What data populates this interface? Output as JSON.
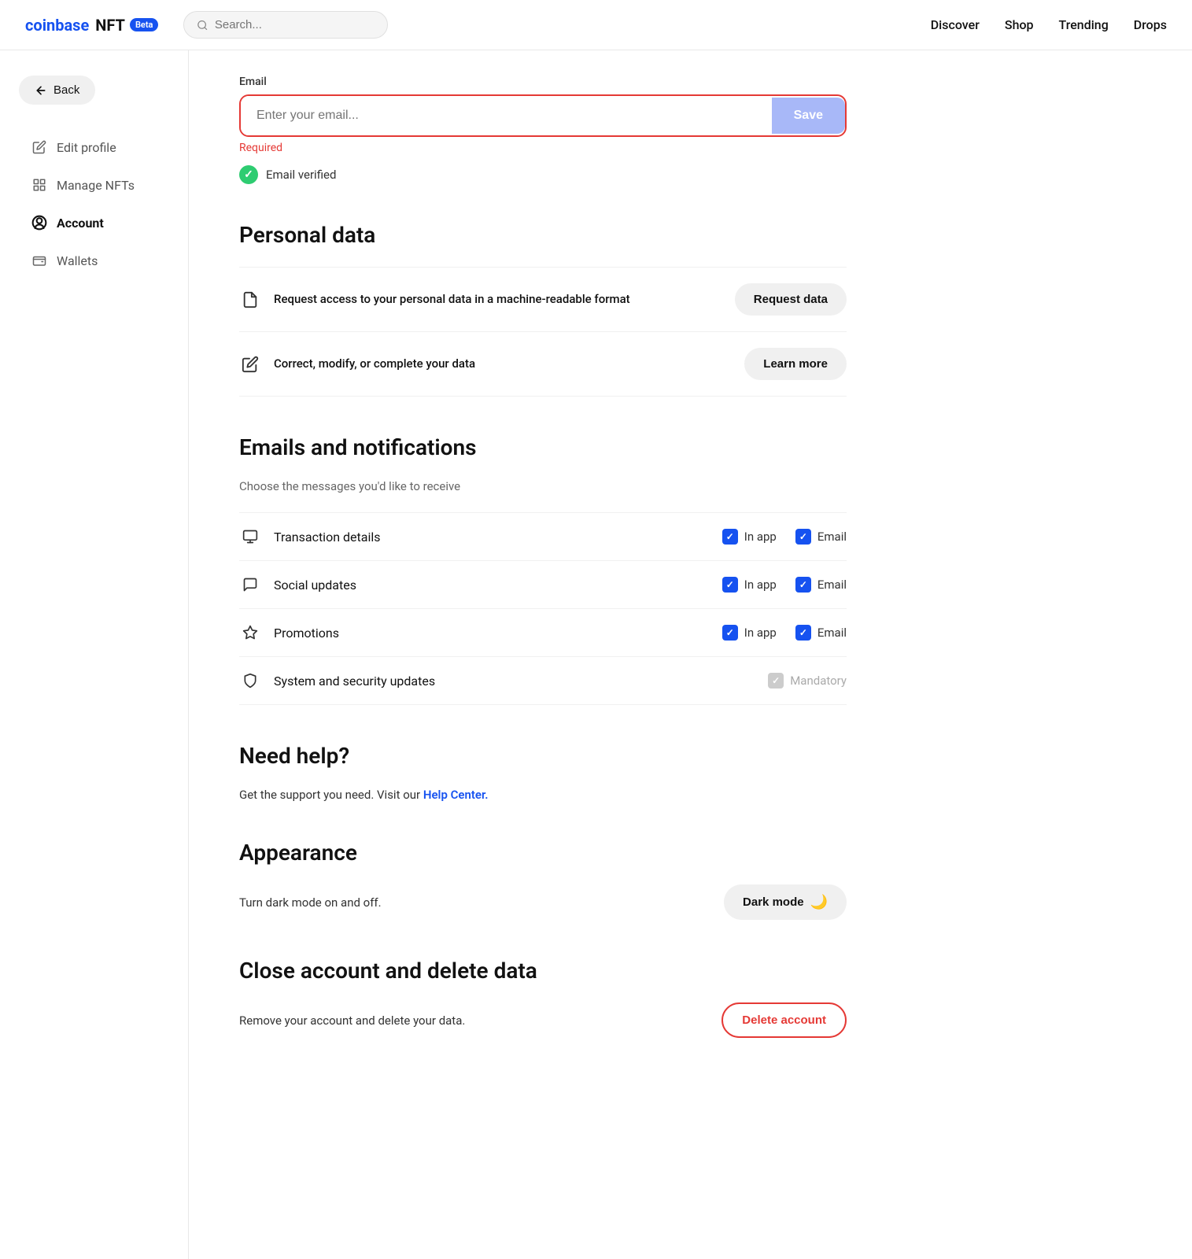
{
  "header": {
    "logo_coinbase": "coinbase",
    "logo_nft": "NFT",
    "beta_badge": "Beta",
    "search_placeholder": "Search...",
    "nav": [
      {
        "label": "Discover",
        "key": "discover"
      },
      {
        "label": "Shop",
        "key": "shop"
      },
      {
        "label": "Trending",
        "key": "trending"
      },
      {
        "label": "Drops",
        "key": "drops"
      }
    ]
  },
  "sidebar": {
    "back_label": "Back",
    "items": [
      {
        "label": "Edit profile",
        "key": "edit-profile",
        "active": false
      },
      {
        "label": "Manage NFTs",
        "key": "manage-nfts",
        "active": false
      },
      {
        "label": "Account",
        "key": "account",
        "active": true
      },
      {
        "label": "Wallets",
        "key": "wallets",
        "active": false
      }
    ]
  },
  "email_section": {
    "label": "Email",
    "placeholder": "Enter your email...",
    "save_label": "Save",
    "required_text": "Required",
    "verified_text": "Email verified"
  },
  "personal_data": {
    "title": "Personal data",
    "rows": [
      {
        "text": "Request access to your personal data in a machine-readable format",
        "action": "Request data"
      },
      {
        "text": "Correct, modify, or complete your data",
        "action": "Learn more"
      }
    ]
  },
  "notifications": {
    "title": "Emails and notifications",
    "subtitle": "Choose the messages you'd like to receive",
    "rows": [
      {
        "label": "Transaction details",
        "in_app": true,
        "email": true,
        "mandatory": false
      },
      {
        "label": "Social updates",
        "in_app": true,
        "email": true,
        "mandatory": false
      },
      {
        "label": "Promotions",
        "in_app": true,
        "email": true,
        "mandatory": false
      },
      {
        "label": "System and security updates",
        "in_app": null,
        "email": null,
        "mandatory": true,
        "mandatory_label": "Mandatory"
      }
    ],
    "in_app_label": "In app",
    "email_label": "Email"
  },
  "help": {
    "title": "Need help?",
    "text": "Get the support you need. Visit our",
    "link_label": "Help Center.",
    "link_href": "#"
  },
  "appearance": {
    "title": "Appearance",
    "description": "Turn dark mode on and off.",
    "dark_mode_label": "Dark mode"
  },
  "close_account": {
    "title": "Close account and delete data",
    "description": "Remove your account and delete your data.",
    "delete_label": "Delete account"
  }
}
